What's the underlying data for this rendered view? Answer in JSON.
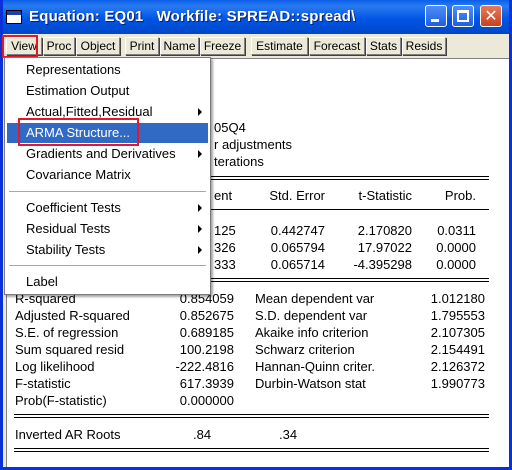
{
  "title": "Equation: EQ01   Workfile: SPREAD::spread\\",
  "toolbar": [
    "View",
    "Proc",
    "Object",
    "Print",
    "Name",
    "Freeze",
    "Estimate",
    "Forecast",
    "Stats",
    "Resids"
  ],
  "menu": {
    "items": [
      "Representations",
      "Estimation Output",
      "Actual,Fitted,Residual",
      "ARMA Structure...",
      "Gradients and Derivatives",
      "Covariance Matrix",
      "Coefficient Tests",
      "Residual Tests",
      "Stability Tests",
      "Label"
    ],
    "selected": "ARMA Structure..."
  },
  "header_fragments": [
    "05Q4",
    "r adjustments",
    "terations"
  ],
  "coef_table": {
    "headers": [
      "ent",
      "Std. Error",
      "t-Statistic",
      "Prob."
    ],
    "rows": [
      [
        "125",
        "0.442747",
        "2.170820",
        "0.0311"
      ],
      [
        "326",
        "0.065794",
        "17.97022",
        "0.0000"
      ],
      [
        "333",
        "0.065714",
        "-4.395298",
        "0.0000"
      ]
    ]
  },
  "stats": [
    [
      "R-squared",
      "0.854059",
      "Mean dependent var",
      "1.012180"
    ],
    [
      "Adjusted R-squared",
      "0.852675",
      "S.D. dependent var",
      "1.795553"
    ],
    [
      "S.E. of regression",
      "0.689185",
      "Akaike info criterion",
      "2.107305"
    ],
    [
      "Sum squared resid",
      "100.2198",
      "Schwarz criterion",
      "2.154491"
    ],
    [
      "Log likelihood",
      "-222.4816",
      "Hannan-Quinn criter.",
      "2.126372"
    ],
    [
      "F-statistic",
      "617.3939",
      "Durbin-Watson stat",
      "1.990773"
    ],
    [
      "Prob(F-statistic)",
      "0.000000",
      "",
      ""
    ]
  ],
  "roots": {
    "label": "Inverted AR Roots",
    "values": [
      ".84",
      ".34"
    ]
  },
  "colors": {
    "title_bar": "#0055E5",
    "menu_highlight": "#316AC5",
    "annotation": "#E3182D"
  }
}
